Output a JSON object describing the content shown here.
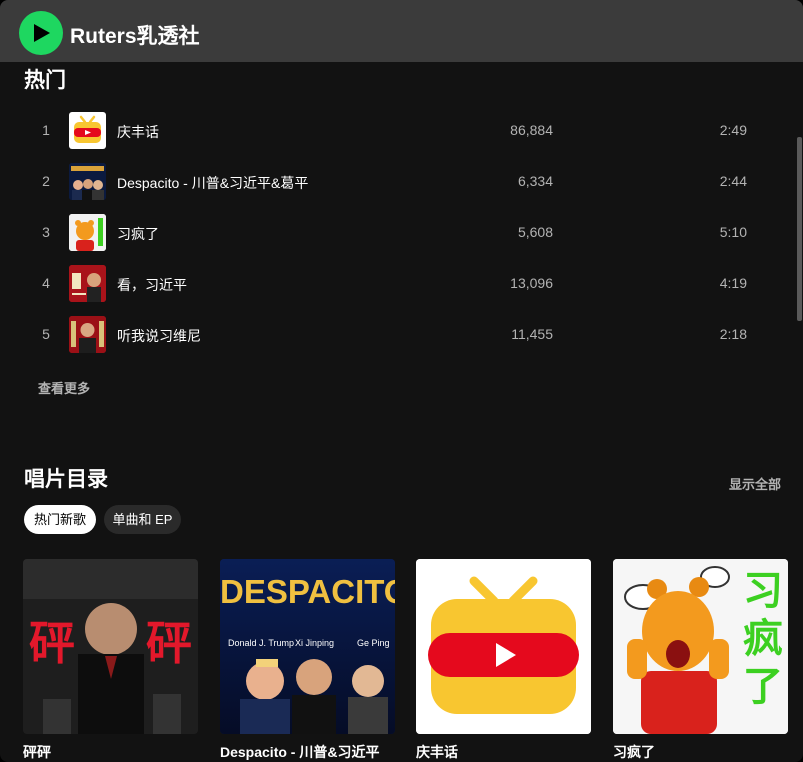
{
  "artist": {
    "name": "Ruters乳透社"
  },
  "popular": {
    "title": "热门",
    "tracks": [
      {
        "num": "1",
        "title": "庆丰话",
        "plays": "86,884",
        "duration": "2:49",
        "thumb": "tv-play-icon"
      },
      {
        "num": "2",
        "title": "Despacito - 川普&习近平&葛平",
        "plays": "6,334",
        "duration": "2:44",
        "thumb": "despacito-cover"
      },
      {
        "num": "3",
        "title": "习疯了",
        "plays": "5,608",
        "duration": "5:10",
        "thumb": "bear-cover"
      },
      {
        "num": "4",
        "title": "看，习近平",
        "plays": "13,096",
        "duration": "4:19",
        "thumb": "red-poster-cover"
      },
      {
        "num": "5",
        "title": "听我说习维尼",
        "plays": "11,455",
        "duration": "2:18",
        "thumb": "red-portrait-cover"
      }
    ],
    "see_more": "查看更多"
  },
  "discography": {
    "title": "唱片目录",
    "show_all": "显示全部",
    "chips": [
      {
        "label": "热门新歌",
        "active": true
      },
      {
        "label": "单曲和 EP",
        "active": false
      }
    ],
    "cards": [
      {
        "title": "砰砰",
        "art": "bangbang-cover",
        "art_text": "砰"
      },
      {
        "title": "Despacito - 川普&习近平",
        "art": "despacito-cover",
        "art_text": "DESPACITO",
        "captions": [
          "Donald J. Trump",
          "Xi Jinping",
          "Ge Ping"
        ]
      },
      {
        "title": "庆丰话",
        "art": "tv-play-icon"
      },
      {
        "title": "习疯了",
        "art": "bear-cover",
        "art_text": "习疯了"
      }
    ]
  },
  "colors": {
    "accent": "#1ed760",
    "header": "#3b3b3b",
    "background": "#121212",
    "muted": "#b3b3b3"
  }
}
